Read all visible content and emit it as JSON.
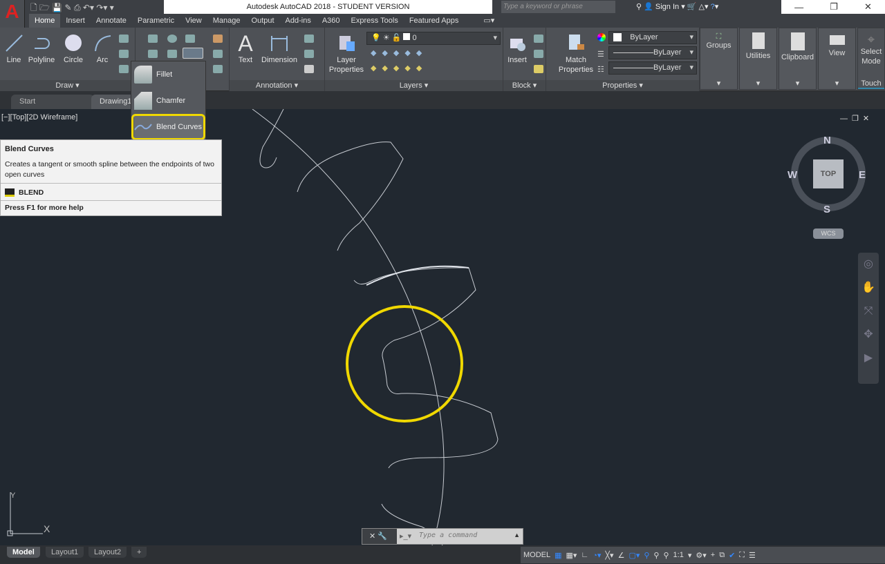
{
  "app": {
    "title": "Autodesk AutoCAD 2018 - STUDENT VERSION",
    "logo": "A",
    "search_placeholder": "Type a keyword or phrase",
    "sign_in": "Sign In"
  },
  "ribbon_tabs": [
    "Home",
    "Insert",
    "Annotate",
    "Parametric",
    "View",
    "Manage",
    "Output",
    "Add-ins",
    "A360",
    "Express Tools",
    "Featured Apps"
  ],
  "draw": {
    "title": "Draw",
    "line": "Line",
    "polyline": "Polyline",
    "circle": "Circle",
    "arc": "Arc"
  },
  "annotation": {
    "title": "Annotation",
    "text": "Text",
    "dimension": "Dimension"
  },
  "layers": {
    "title": "Layers",
    "layer_properties": "Layer\nProperties",
    "current_layer": "0"
  },
  "block": {
    "title": "Block",
    "insert": "Insert"
  },
  "properties": {
    "title": "Properties",
    "match": "Match\nProperties",
    "color": "ByLayer",
    "linetype": "ByLayer",
    "lineweight": "ByLayer"
  },
  "groups": "Groups",
  "utilities": "Utilities",
  "clipboard": "Clipboard",
  "view": "View",
  "select_mode": "Select\nMode",
  "touch": "Touch",
  "file_tabs": [
    "Start",
    "Drawing1"
  ],
  "viewport": {
    "label": "[−][Top][2D Wireframe]",
    "wcs": "WCS",
    "compass": {
      "n": "N",
      "s": "S",
      "e": "E",
      "w": "W",
      "top": "TOP"
    },
    "ucs_y": "Y",
    "ucs_x": "X"
  },
  "flyout": {
    "items": [
      "Fillet",
      "Chamfer",
      "Blend Curves"
    ],
    "highlighted": "Blend Curves"
  },
  "tooltip": {
    "title": "Blend Curves",
    "description": "Creates a tangent or smooth spline between the endpoints of two open curves",
    "command": "BLEND",
    "help": "Press F1 for more help"
  },
  "command_line": {
    "placeholder": "Type a command"
  },
  "layout_tabs": [
    "Model",
    "Layout1",
    "Layout2"
  ],
  "status_bar": {
    "model": "MODEL",
    "scale": "1:1"
  },
  "colors": {
    "viewport_bg": "#212830",
    "highlight": "#f0d800",
    "accent": "#2f8fe0"
  }
}
